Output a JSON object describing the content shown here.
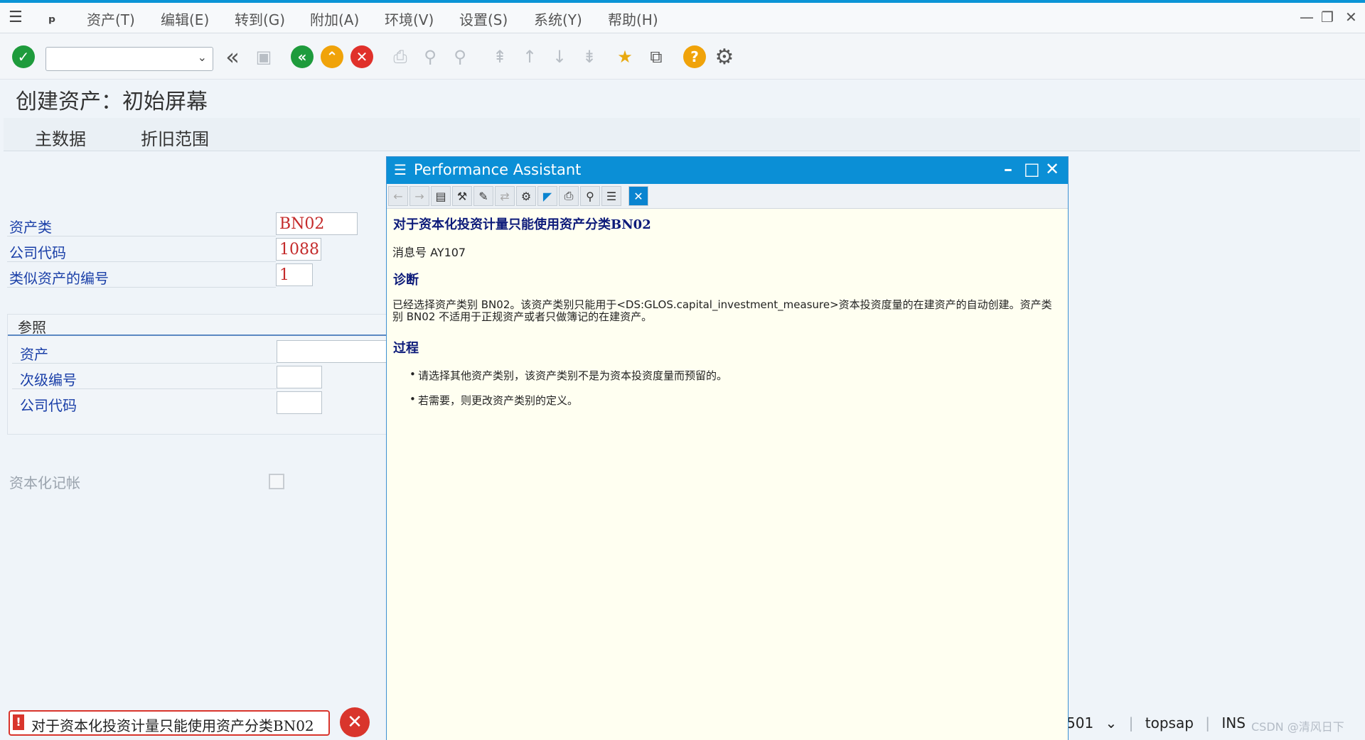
{
  "menubar": {
    "items": [
      "资产(T)",
      "编辑(E)",
      "转到(G)",
      "附加(A)",
      "环境(V)",
      "设置(S)",
      "系统(Y)",
      "帮助(H)"
    ]
  },
  "toolbar": {
    "command_field_value": ""
  },
  "page": {
    "title": "创建资产：初始屏幕",
    "tabs": [
      "主数据",
      "折旧范围"
    ]
  },
  "form": {
    "asset_class_label": "资产类",
    "asset_class_value": "BN02",
    "company_code_label": "公司代码",
    "company_code_value": "1088",
    "similar_assets_label": "类似资产的编号",
    "similar_assets_value": "1",
    "reference_group": {
      "title": "参照",
      "asset_label": "资产",
      "subnumber_label": "次级编号",
      "company_code_label": "公司代码"
    },
    "capitalization_label": "资本化记帐"
  },
  "popup": {
    "title": "Performance Assistant",
    "heading": "对于资本化投资计量只能使用资产分类BN02",
    "message_number": "消息号 AY107",
    "diagnosis_title": "诊断",
    "diagnosis_text": "已经选择资产类别 BN02。该资产类别只能用于<DS:GLOS.capital_investment_measure>资本投资度量的在建资产的自动创建。资产类别 BN02 不适用于正规资产或者只做簿记的在建资产。",
    "procedure_title": "过程",
    "procedure_items": [
      "请选择其他资产类别，该资产类别不是为资本投资度量而预留的。",
      "若需要，则更改资产类别的定义。"
    ]
  },
  "statusbar": {
    "message": "对于资本化投资计量只能使用资产分类BN02",
    "client": "501",
    "system": "topsap",
    "mode": "INS",
    "watermark": "CSDN @清风日下"
  }
}
